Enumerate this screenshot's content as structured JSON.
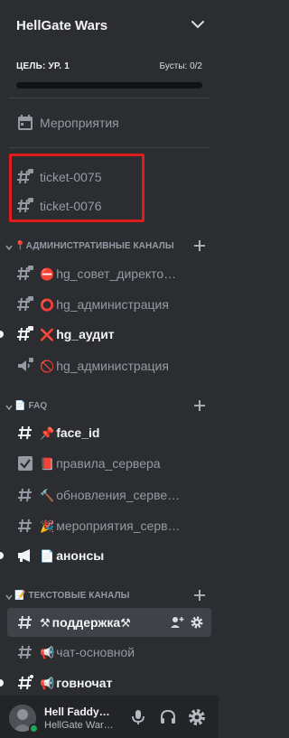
{
  "server": {
    "name": "HellGate Wars"
  },
  "boost": {
    "goal": "ЦЕЛЬ: УР. 1",
    "boosts": "Бусты: 0/2",
    "progress": 0
  },
  "events": {
    "label": "Мероприятия"
  },
  "tickets": [
    "ticket-0075",
    "ticket-0076"
  ],
  "categories": {
    "admin": {
      "label": "АДМИНИСТРАТИВНЫЕ КАНАЛЫ",
      "emoji": "📍"
    },
    "faq": {
      "label": "FAQ",
      "emoji": "📄"
    },
    "text": {
      "label": "ТЕКСТОВЫЕ КАНАЛЫ",
      "emoji": "📝"
    }
  },
  "channels": {
    "admin": [
      {
        "emoji": "⛔",
        "name": "hg_совет_директо…"
      },
      {
        "emoji": "⭕",
        "name": "hg_администрация"
      },
      {
        "emoji": "❌",
        "name": "hg_аудит"
      },
      {
        "emoji": "🚫",
        "name": "hg_администрация"
      }
    ],
    "faq": [
      {
        "emoji": "📌",
        "name": "face_id"
      },
      {
        "emoji": "📕",
        "name": "правила_сервера"
      },
      {
        "emoji": "🔨",
        "name": "обновления_серве…"
      },
      {
        "emoji": "🎉",
        "name": "мероприятия_серв…"
      },
      {
        "emoji": "📄",
        "name": "анонсы"
      }
    ],
    "text": [
      {
        "emoji": "⚒",
        "name": "поддержка",
        "suffix": "⚒"
      },
      {
        "emoji": "📢",
        "name": "чат-основной"
      },
      {
        "emoji": "📢",
        "name": "говночат"
      }
    ]
  },
  "user": {
    "name": "Hell Faddy…",
    "sub": "HellGate War…"
  },
  "colors": {
    "bg": "#2b2d31",
    "panel": "#232428",
    "muted": "#949ba4",
    "white": "#f2f3f5",
    "highlight": "#e11c1c",
    "online": "#23a55a"
  }
}
